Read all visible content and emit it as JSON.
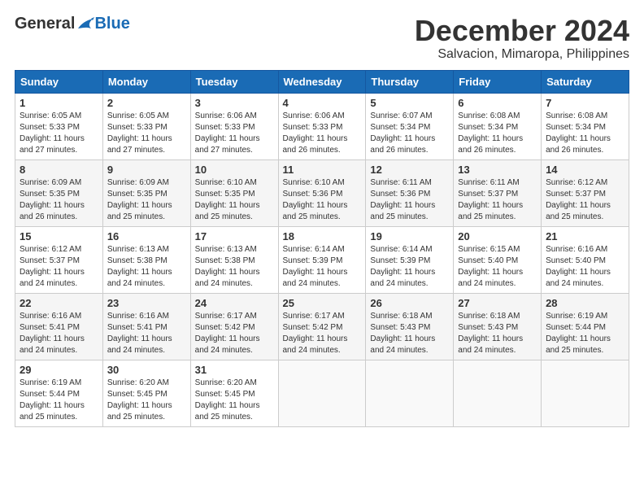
{
  "header": {
    "logo_general": "General",
    "logo_blue": "Blue",
    "month_title": "December 2024",
    "location": "Salvacion, Mimaropa, Philippines"
  },
  "weekdays": [
    "Sunday",
    "Monday",
    "Tuesday",
    "Wednesday",
    "Thursday",
    "Friday",
    "Saturday"
  ],
  "weeks": [
    [
      {
        "day": "1",
        "info": "Sunrise: 6:05 AM\nSunset: 5:33 PM\nDaylight: 11 hours\nand 27 minutes."
      },
      {
        "day": "2",
        "info": "Sunrise: 6:05 AM\nSunset: 5:33 PM\nDaylight: 11 hours\nand 27 minutes."
      },
      {
        "day": "3",
        "info": "Sunrise: 6:06 AM\nSunset: 5:33 PM\nDaylight: 11 hours\nand 27 minutes."
      },
      {
        "day": "4",
        "info": "Sunrise: 6:06 AM\nSunset: 5:33 PM\nDaylight: 11 hours\nand 26 minutes."
      },
      {
        "day": "5",
        "info": "Sunrise: 6:07 AM\nSunset: 5:34 PM\nDaylight: 11 hours\nand 26 minutes."
      },
      {
        "day": "6",
        "info": "Sunrise: 6:08 AM\nSunset: 5:34 PM\nDaylight: 11 hours\nand 26 minutes."
      },
      {
        "day": "7",
        "info": "Sunrise: 6:08 AM\nSunset: 5:34 PM\nDaylight: 11 hours\nand 26 minutes."
      }
    ],
    [
      {
        "day": "8",
        "info": "Sunrise: 6:09 AM\nSunset: 5:35 PM\nDaylight: 11 hours\nand 26 minutes."
      },
      {
        "day": "9",
        "info": "Sunrise: 6:09 AM\nSunset: 5:35 PM\nDaylight: 11 hours\nand 25 minutes."
      },
      {
        "day": "10",
        "info": "Sunrise: 6:10 AM\nSunset: 5:35 PM\nDaylight: 11 hours\nand 25 minutes."
      },
      {
        "day": "11",
        "info": "Sunrise: 6:10 AM\nSunset: 5:36 PM\nDaylight: 11 hours\nand 25 minutes."
      },
      {
        "day": "12",
        "info": "Sunrise: 6:11 AM\nSunset: 5:36 PM\nDaylight: 11 hours\nand 25 minutes."
      },
      {
        "day": "13",
        "info": "Sunrise: 6:11 AM\nSunset: 5:37 PM\nDaylight: 11 hours\nand 25 minutes."
      },
      {
        "day": "14",
        "info": "Sunrise: 6:12 AM\nSunset: 5:37 PM\nDaylight: 11 hours\nand 25 minutes."
      }
    ],
    [
      {
        "day": "15",
        "info": "Sunrise: 6:12 AM\nSunset: 5:37 PM\nDaylight: 11 hours\nand 24 minutes."
      },
      {
        "day": "16",
        "info": "Sunrise: 6:13 AM\nSunset: 5:38 PM\nDaylight: 11 hours\nand 24 minutes."
      },
      {
        "day": "17",
        "info": "Sunrise: 6:13 AM\nSunset: 5:38 PM\nDaylight: 11 hours\nand 24 minutes."
      },
      {
        "day": "18",
        "info": "Sunrise: 6:14 AM\nSunset: 5:39 PM\nDaylight: 11 hours\nand 24 minutes."
      },
      {
        "day": "19",
        "info": "Sunrise: 6:14 AM\nSunset: 5:39 PM\nDaylight: 11 hours\nand 24 minutes."
      },
      {
        "day": "20",
        "info": "Sunrise: 6:15 AM\nSunset: 5:40 PM\nDaylight: 11 hours\nand 24 minutes."
      },
      {
        "day": "21",
        "info": "Sunrise: 6:16 AM\nSunset: 5:40 PM\nDaylight: 11 hours\nand 24 minutes."
      }
    ],
    [
      {
        "day": "22",
        "info": "Sunrise: 6:16 AM\nSunset: 5:41 PM\nDaylight: 11 hours\nand 24 minutes."
      },
      {
        "day": "23",
        "info": "Sunrise: 6:16 AM\nSunset: 5:41 PM\nDaylight: 11 hours\nand 24 minutes."
      },
      {
        "day": "24",
        "info": "Sunrise: 6:17 AM\nSunset: 5:42 PM\nDaylight: 11 hours\nand 24 minutes."
      },
      {
        "day": "25",
        "info": "Sunrise: 6:17 AM\nSunset: 5:42 PM\nDaylight: 11 hours\nand 24 minutes."
      },
      {
        "day": "26",
        "info": "Sunrise: 6:18 AM\nSunset: 5:43 PM\nDaylight: 11 hours\nand 24 minutes."
      },
      {
        "day": "27",
        "info": "Sunrise: 6:18 AM\nSunset: 5:43 PM\nDaylight: 11 hours\nand 24 minutes."
      },
      {
        "day": "28",
        "info": "Sunrise: 6:19 AM\nSunset: 5:44 PM\nDaylight: 11 hours\nand 25 minutes."
      }
    ],
    [
      {
        "day": "29",
        "info": "Sunrise: 6:19 AM\nSunset: 5:44 PM\nDaylight: 11 hours\nand 25 minutes."
      },
      {
        "day": "30",
        "info": "Sunrise: 6:20 AM\nSunset: 5:45 PM\nDaylight: 11 hours\nand 25 minutes."
      },
      {
        "day": "31",
        "info": "Sunrise: 6:20 AM\nSunset: 5:45 PM\nDaylight: 11 hours\nand 25 minutes."
      },
      {
        "day": "",
        "info": ""
      },
      {
        "day": "",
        "info": ""
      },
      {
        "day": "",
        "info": ""
      },
      {
        "day": "",
        "info": ""
      }
    ]
  ]
}
